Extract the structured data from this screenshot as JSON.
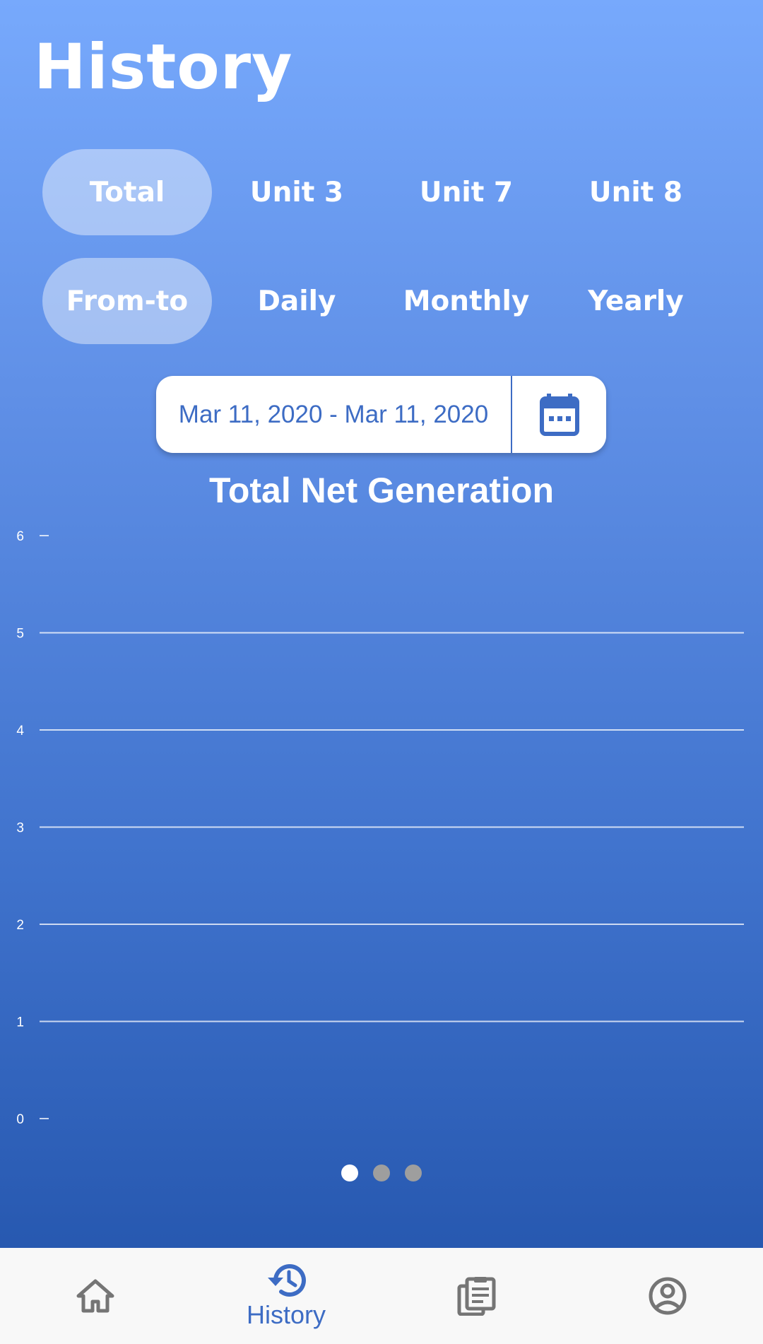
{
  "header": {
    "title": "History"
  },
  "unit_tabs": [
    {
      "label": "Total",
      "active": true
    },
    {
      "label": "Unit 3",
      "active": false
    },
    {
      "label": "Unit 7",
      "active": false
    },
    {
      "label": "Unit 8",
      "active": false
    }
  ],
  "period_tabs": [
    {
      "label": "From-to",
      "active": true
    },
    {
      "label": "Daily",
      "active": false
    },
    {
      "label": "Monthly",
      "active": false
    },
    {
      "label": "Yearly",
      "active": false
    }
  ],
  "date_range": {
    "text": "Mar 11, 2020 - Mar 11, 2020",
    "icon": "calendar-icon"
  },
  "chart_data": {
    "type": "line",
    "title": "Total Net Generation",
    "xlabel": "",
    "ylabel": "",
    "ylim": [
      0,
      6
    ],
    "yticks": [
      "0",
      "1",
      "2",
      "3",
      "4",
      "5",
      "6"
    ],
    "series": [],
    "grid": true
  },
  "pager": {
    "count": 3,
    "active_index": 0
  },
  "bottom_nav": {
    "items": [
      {
        "icon": "home-icon",
        "label": "",
        "active": false
      },
      {
        "icon": "history-icon",
        "label": "History",
        "active": true
      },
      {
        "icon": "clipboard-icon",
        "label": "",
        "active": false
      },
      {
        "icon": "account-icon",
        "label": "",
        "active": false
      }
    ]
  },
  "colors": {
    "accent": "#3d6cc4",
    "inactive_icon": "#757575",
    "gradient_top": "#77a9fc",
    "gradient_bottom": "#2152a9"
  }
}
